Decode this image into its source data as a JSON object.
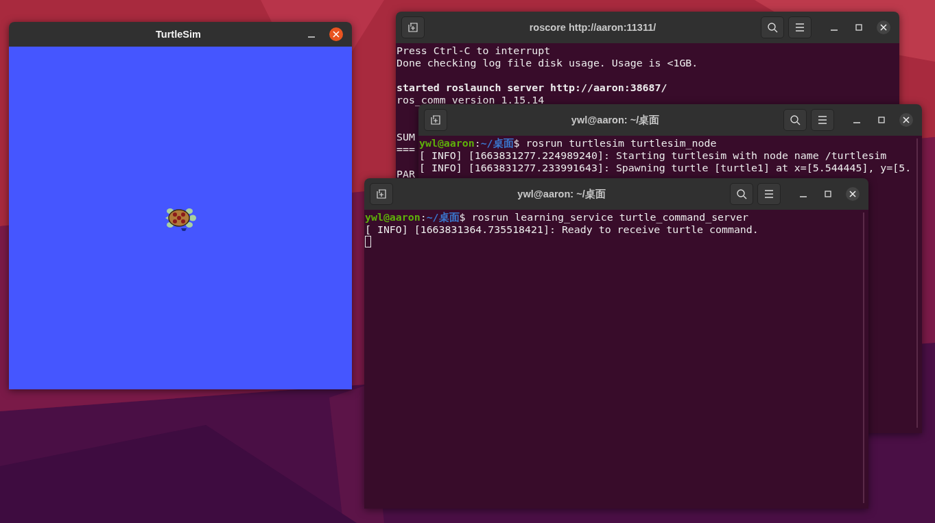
{
  "windows": [
    {
      "kind": "turtlesim",
      "title": "TurtleSim"
    },
    {
      "kind": "terminal",
      "title": "roscore http://aaron:11311/",
      "lines": [
        {
          "text": "Press Ctrl-C to interrupt"
        },
        {
          "text": "Done checking log file disk usage. Usage is <1GB."
        },
        {
          "kind": "blank"
        },
        {
          "text": "started roslaunch server http://aaron:38687/",
          "bold": true
        },
        {
          "text": "ros_comm version 1.15.14"
        },
        {
          "kind": "blank"
        },
        {
          "kind": "blank"
        },
        {
          "text": "SUM"
        },
        {
          "text": "==="
        },
        {
          "kind": "blank"
        },
        {
          "text": "PAR"
        }
      ]
    },
    {
      "kind": "terminal",
      "title": "ywl@aaron: ~/桌面",
      "lines": [
        {
          "prompt_user": "ywl@aaron",
          "prompt_sep": ":",
          "prompt_path": "~/桌面",
          "text": "$ rosrun turtlesim turtlesim_node"
        },
        {
          "text": "[ INFO] [1663831277.224989240]: Starting turtlesim with node name /turtlesim"
        },
        {
          "text": "[ INFO] [1663831277.233991643]: Spawning turtle [turtle1] at x=[5.544445], y=[5."
        }
      ]
    },
    {
      "kind": "terminal",
      "title": "ywl@aaron: ~/桌面",
      "cursor": true,
      "lines": [
        {
          "prompt_user": "ywl@aaron",
          "prompt_sep": ":",
          "prompt_path": "~/桌面",
          "text": "$ rosrun learning_service turtle_command_server"
        },
        {
          "text": "[ INFO] [1663831364.735518421]: Ready to receive turtle command."
        }
      ]
    }
  ]
}
